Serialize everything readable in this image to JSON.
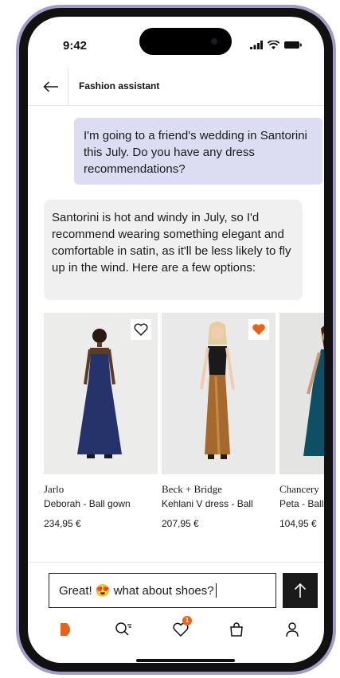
{
  "status_bar": {
    "time": "9:42"
  },
  "header": {
    "title": "Fashion assistant"
  },
  "chat": {
    "user_message": "I'm going to a friend's wedding in Santorini this July. Do you have any dress recommendations?",
    "assistant_message": "Santorini is hot and windy in July, so I'd recommend wearing something elegant and comfortable in satin, as it'll be less likely to fly up in the wind. Here are a few options:"
  },
  "products": [
    {
      "brand": "Jarlo",
      "name": "Deborah - Ball gown",
      "price": "234,95 €",
      "favorited": false,
      "dress_color": "#26336b"
    },
    {
      "brand": "Beck + Bridge",
      "name": "Kehlani V dress - Ball",
      "price": "207,95 €",
      "favorited": true,
      "dress_color": "#a5692e"
    },
    {
      "brand": "Chancery",
      "name": "Peta - Ball",
      "price": "104,95 €",
      "favorited": false,
      "dress_color": "#0f4f66"
    }
  ],
  "composer": {
    "value": "Great! 😍 what about shoes?"
  },
  "nav": {
    "items": [
      "home-icon",
      "search-icon",
      "heart-icon",
      "bag-icon",
      "profile-icon"
    ],
    "favorites_badge": "1"
  },
  "colors": {
    "accent": "#e8631a",
    "user_bubble": "#dcdcf3",
    "assistant_bubble": "#f0f0f1",
    "frame": "#a59bc9"
  }
}
